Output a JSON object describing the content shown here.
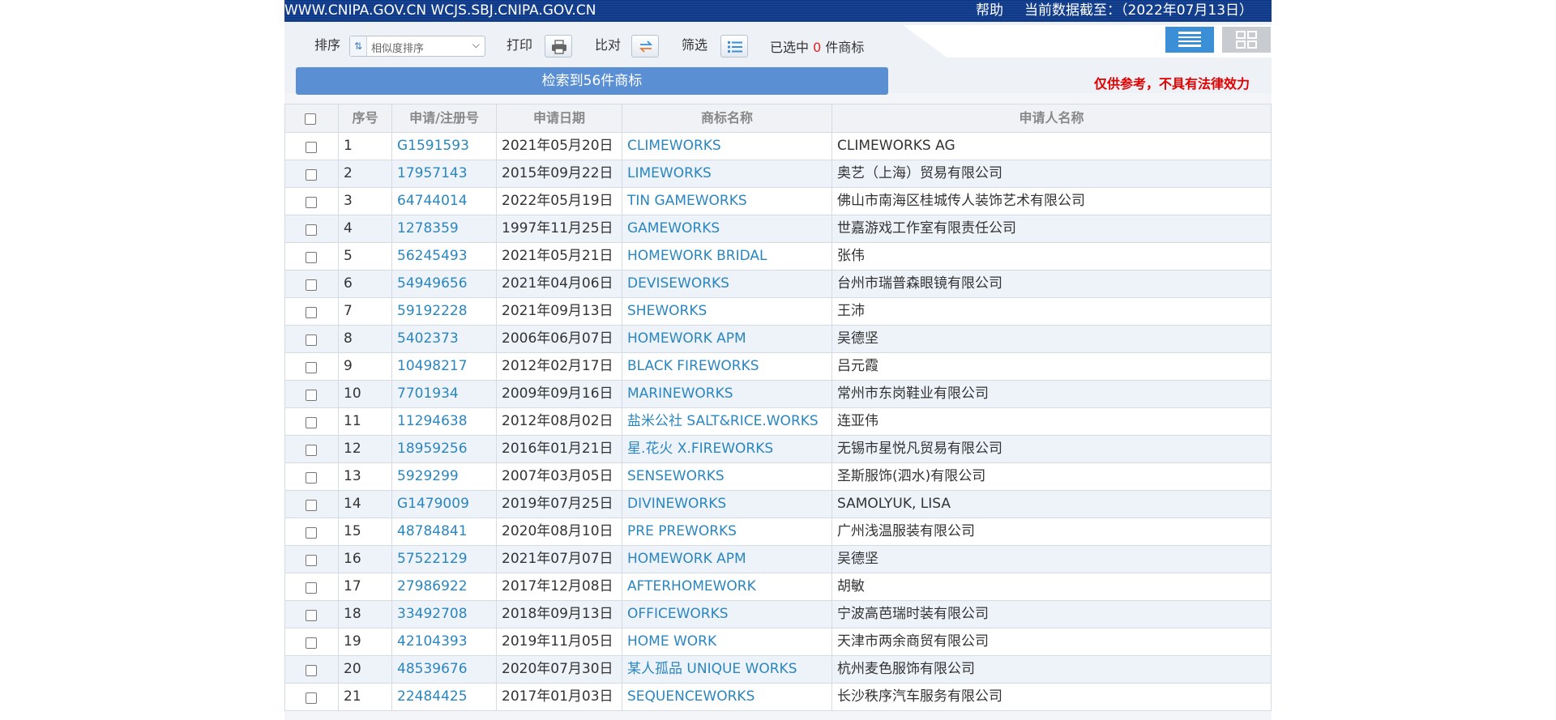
{
  "topbar": {
    "site": "WWW.CNIPA.GOV.CN WCJS.SBJ.CNIPA.GOV.CN",
    "help": "帮助",
    "date_info": "当前数据截至：（2022年07月13日）"
  },
  "toolbar": {
    "sort_label": "排序",
    "sort_value": "相似度排序",
    "print_label": "打印",
    "compare_label": "比对",
    "filter_label": "筛选",
    "selected_prefix": "已选中",
    "selected_count": "0",
    "selected_suffix": "件商标",
    "result_text": "检索到56件商标",
    "disclaimer": "仅供参考，不具有法律效力"
  },
  "icons": {
    "print": "printer-icon",
    "compare": "compare-icon",
    "filter": "filter-list-icon",
    "list_view": "list-view-icon",
    "grid_view": "grid-view-icon"
  },
  "colors": {
    "topbar": "#0f3a8a",
    "result_bar": "#5b8fd3",
    "link": "#2a86bf",
    "disclaimer": "#e00000",
    "list_view_active": "#3a8fd6"
  },
  "table": {
    "headers": [
      "序号",
      "申请/注册号",
      "申请日期",
      "商标名称",
      "申请人名称"
    ],
    "rows": [
      {
        "no": "1",
        "reg": "G1591593",
        "date": "2021年05月20日",
        "name": "CLIMEWORKS",
        "applicant": "CLIMEWORKS AG"
      },
      {
        "no": "2",
        "reg": "17957143",
        "date": "2015年09月22日",
        "name": "LIMEWORKS",
        "applicant": "奥艺（上海）贸易有限公司"
      },
      {
        "no": "3",
        "reg": "64744014",
        "date": "2022年05月19日",
        "name": "TIN GAMEWORKS",
        "applicant": "佛山市南海区桂城传人装饰艺术有限公司"
      },
      {
        "no": "4",
        "reg": "1278359",
        "date": "1997年11月25日",
        "name": "GAMEWORKS",
        "applicant": "世嘉游戏工作室有限责任公司"
      },
      {
        "no": "5",
        "reg": "56245493",
        "date": "2021年05月21日",
        "name": "HOMEWORK BRIDAL",
        "applicant": "张伟"
      },
      {
        "no": "6",
        "reg": "54949656",
        "date": "2021年04月06日",
        "name": "DEVISEWORKS",
        "applicant": "台州市瑞普森眼镜有限公司"
      },
      {
        "no": "7",
        "reg": "59192228",
        "date": "2021年09月13日",
        "name": "SHEWORKS",
        "applicant": "王沛"
      },
      {
        "no": "8",
        "reg": "5402373",
        "date": "2006年06月07日",
        "name": "HOMEWORK APM",
        "applicant": "吴德坚"
      },
      {
        "no": "9",
        "reg": "10498217",
        "date": "2012年02月17日",
        "name": "BLACK FIREWORKS",
        "applicant": "吕元霞"
      },
      {
        "no": "10",
        "reg": "7701934",
        "date": "2009年09月16日",
        "name": "MARINEWORKS",
        "applicant": "常州市东岗鞋业有限公司"
      },
      {
        "no": "11",
        "reg": "11294638",
        "date": "2012年08月02日",
        "name": "盐米公社 SALT&RICE.WORKS",
        "applicant": "连亚伟"
      },
      {
        "no": "12",
        "reg": "18959256",
        "date": "2016年01月21日",
        "name": "星.花火 X.FIREWORKS",
        "applicant": "无锡市星悦凡贸易有限公司"
      },
      {
        "no": "13",
        "reg": "5929299",
        "date": "2007年03月05日",
        "name": "SENSEWORKS",
        "applicant": "圣斯服饰(泗水)有限公司"
      },
      {
        "no": "14",
        "reg": "G1479009",
        "date": "2019年07月25日",
        "name": "DIVINEWORKS",
        "applicant": "SAMOLYUK, LISA"
      },
      {
        "no": "15",
        "reg": "48784841",
        "date": "2020年08月10日",
        "name": "PRE PREWORKS",
        "applicant": "广州浅温服装有限公司"
      },
      {
        "no": "16",
        "reg": "57522129",
        "date": "2021年07月07日",
        "name": "HOMEWORK APM",
        "applicant": "吴德坚"
      },
      {
        "no": "17",
        "reg": "27986922",
        "date": "2017年12月08日",
        "name": "AFTERHOMEWORK",
        "applicant": "胡敏"
      },
      {
        "no": "18",
        "reg": "33492708",
        "date": "2018年09月13日",
        "name": "OFFICEWORKS",
        "applicant": "宁波高芭瑞时装有限公司"
      },
      {
        "no": "19",
        "reg": "42104393",
        "date": "2019年11月05日",
        "name": "HOME WORK",
        "applicant": "天津市两余商贸有限公司"
      },
      {
        "no": "20",
        "reg": "48539676",
        "date": "2020年07月30日",
        "name": "某人孤品 UNIQUE WORKS",
        "applicant": "杭州麦色服饰有限公司"
      },
      {
        "no": "21",
        "reg": "22484425",
        "date": "2017年01月03日",
        "name": "SEQUENCEWORKS",
        "applicant": "长沙秩序汽车服务有限公司"
      }
    ]
  }
}
